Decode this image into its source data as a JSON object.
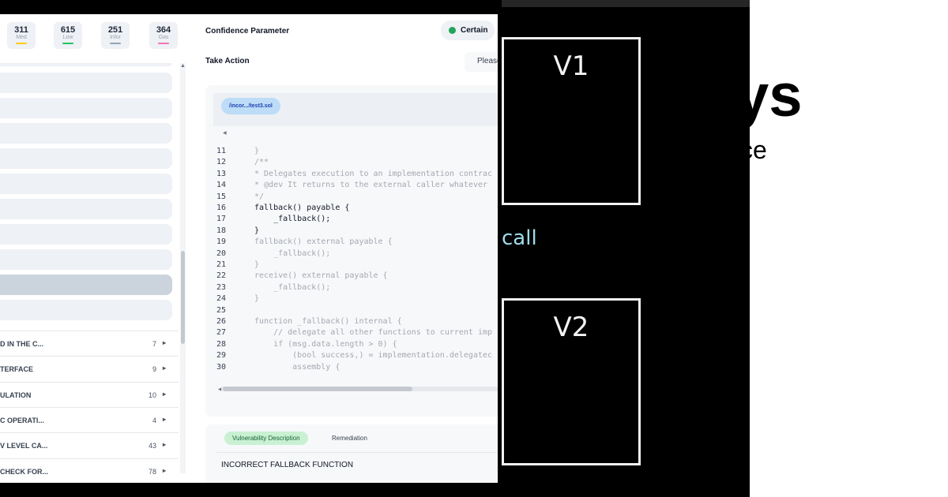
{
  "stats": [
    {
      "value": "311",
      "label": "Med",
      "color": "#facc15"
    },
    {
      "value": "615",
      "label": "Low",
      "color": "#22c55e"
    },
    {
      "value": "251",
      "label": "Infor",
      "color": "#94a3b8"
    },
    {
      "value": "364",
      "label": "Gas",
      "color": "#f472b6"
    }
  ],
  "sidebar": {
    "categories": [
      {
        "title": "D IN THE C...",
        "count": "7"
      },
      {
        "title": "TERFACE",
        "count": "9"
      },
      {
        "title": "ULATION",
        "count": "10"
      },
      {
        "title": "C OPERATI...",
        "count": "4"
      },
      {
        "title": "V LEVEL CA...",
        "count": "43"
      },
      {
        "title": "CHECK FOR...",
        "count": "78"
      }
    ]
  },
  "header": {
    "confidence_label": "Confidence Parameter",
    "confidence_value": "Certain",
    "action_label": "Take Action",
    "action_placeholder": "Please"
  },
  "code": {
    "file_tab": "/incor.../test3.sol",
    "lines": [
      {
        "n": "11",
        "text": "}",
        "strong": false
      },
      {
        "n": "12",
        "text": "/**",
        "strong": false
      },
      {
        "n": "13",
        "text": "* Delegates execution to an implementation contrac",
        "strong": false
      },
      {
        "n": "14",
        "text": "* @dev It returns to the external caller whatever",
        "strong": false
      },
      {
        "n": "15",
        "text": "*/",
        "strong": false
      },
      {
        "n": "16",
        "text": "fallback() payable {",
        "strong": true
      },
      {
        "n": "17",
        "text": "    _fallback();",
        "strong": true
      },
      {
        "n": "18",
        "text": "}",
        "strong": true
      },
      {
        "n": "19",
        "text": "fallback() external payable {",
        "strong": false
      },
      {
        "n": "20",
        "text": "    _fallback();",
        "strong": false
      },
      {
        "n": "21",
        "text": "}",
        "strong": false
      },
      {
        "n": "22",
        "text": "receive() external payable {",
        "strong": false
      },
      {
        "n": "23",
        "text": "    _fallback();",
        "strong": false
      },
      {
        "n": "24",
        "text": "}",
        "strong": false
      },
      {
        "n": "25",
        "text": "",
        "strong": false
      },
      {
        "n": "26",
        "text": "function _fallback() internal {",
        "strong": false
      },
      {
        "n": "27",
        "text": "    // delegate all other functions to current imp",
        "strong": false
      },
      {
        "n": "28",
        "text": "    if (msg.data.length > 0) {",
        "strong": false
      },
      {
        "n": "29",
        "text": "        (bool success,) = implementation.delegatec",
        "strong": false
      },
      {
        "n": "30",
        "text": "        assembly {",
        "strong": false
      }
    ]
  },
  "description": {
    "tab_active": "Vulnerability Description",
    "tab_other": "Remediation",
    "title": "INCORRECT FALLBACK FUNCTION"
  },
  "video": {
    "box1": "V1",
    "box2": "V2",
    "call_text": "call"
  },
  "slide": {
    "big_text": "ys",
    "sub_text": "ce"
  }
}
